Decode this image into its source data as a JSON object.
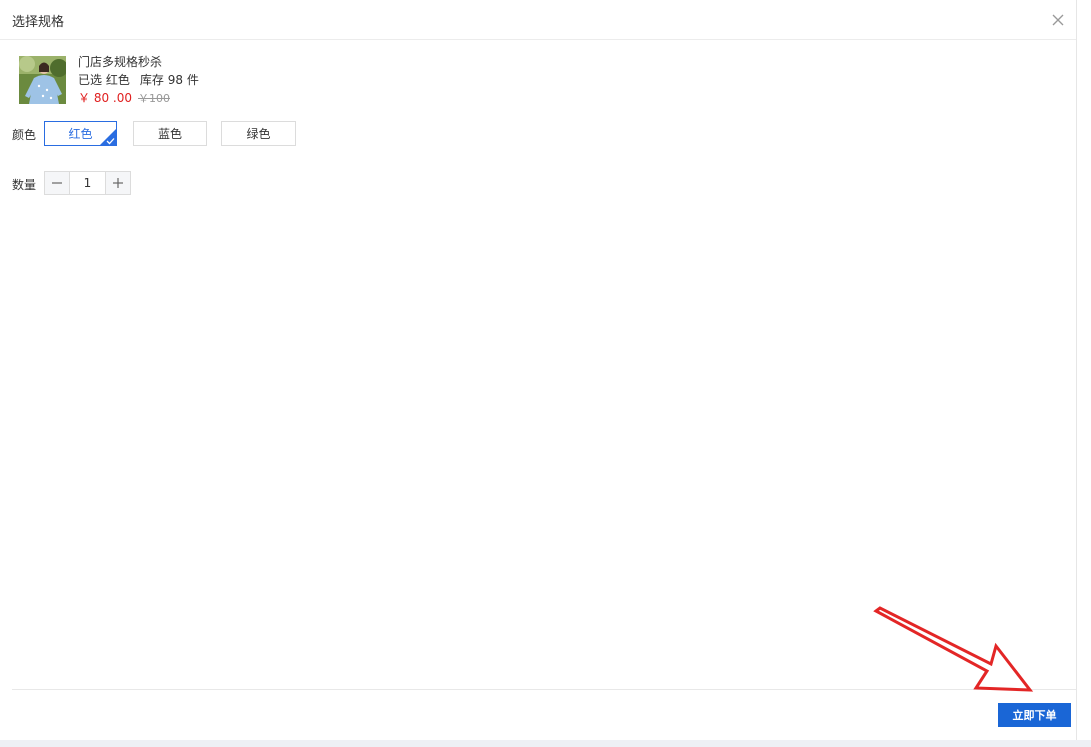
{
  "dialog": {
    "title": "选择规格"
  },
  "product": {
    "name": "门店多规格秒杀",
    "selected_label": "已选",
    "selected_value": "红色",
    "stock_label": "库存",
    "stock_value": "98",
    "stock_unit": "件",
    "price_now": "￥ 80 .00",
    "price_old": "￥100"
  },
  "spec": {
    "label": "颜色",
    "options": [
      "红色",
      "蓝色",
      "绿色"
    ],
    "selected_index": 0
  },
  "quantity": {
    "label": "数量",
    "value": "1",
    "minus": "−",
    "plus": "+"
  },
  "footer": {
    "submit_label": "立即下单"
  },
  "colors": {
    "accent": "#2a6de1",
    "submit": "#1a66d6",
    "price": "#e02020",
    "annotation_arrow": "#e32626"
  },
  "icons": {
    "close": "close-icon",
    "check": "check-icon",
    "arrow": "annotation-arrow"
  }
}
